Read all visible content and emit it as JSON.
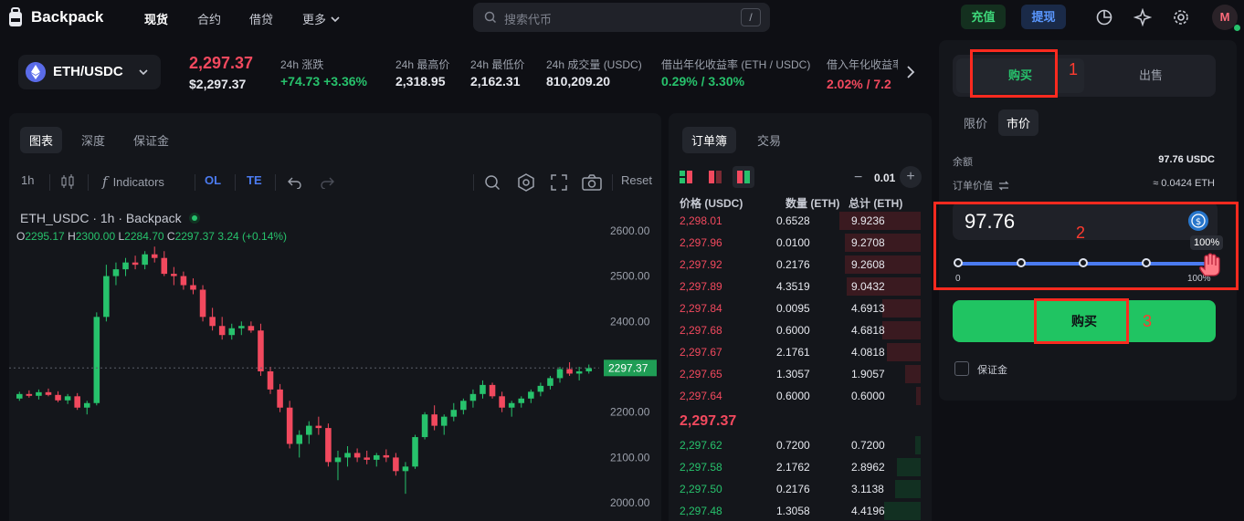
{
  "nav": {
    "brand": "Backpack",
    "items": [
      "现货",
      "合约",
      "借贷",
      "更多"
    ],
    "search_placeholder": "搜索代币",
    "search_shortcut": "/",
    "deposit": "充值",
    "withdraw": "提现",
    "avatar": "M"
  },
  "ticker": {
    "pair": "ETH/USDC",
    "last_price": "2,297.37",
    "last_usd": "$2,297.37",
    "stats": [
      {
        "label": "24h 涨跌",
        "value": "+74.73 +3.36%"
      },
      {
        "label": "24h 最高价",
        "value": "2,318.95"
      },
      {
        "label": "24h 最低价",
        "value": "2,162.31"
      },
      {
        "label": "24h 成交量 (USDC)",
        "value": "810,209.20"
      },
      {
        "label": "借出年化收益率 (ETH / USDC)",
        "value": "0.29% / 3.30%"
      },
      {
        "label": "借入年化收益率",
        "value": "2.02% / 7.2"
      }
    ]
  },
  "chart": {
    "tabs": [
      "图表",
      "深度",
      "保证金"
    ],
    "interval": "1h",
    "indicators": "Indicators",
    "ol": "OL",
    "te": "TE",
    "reset": "Reset",
    "title": "ETH_USDC · 1h · Backpack",
    "ohlc": {
      "o_label": "O",
      "o": "2295.17",
      "h_label": "H",
      "h": "2300.00",
      "l_label": "L",
      "l": "2284.70",
      "c_label": "C",
      "c": "2297.37",
      "change": "3.24 (+0.14%)"
    },
    "current_price_tag": "2297.37"
  },
  "chart_data": {
    "type": "candlestick",
    "title": "ETH_USDC · 1h · Backpack",
    "y_ticks": [
      "2600.00",
      "2500.00",
      "2400.00",
      "2300.00",
      "2200.00",
      "2100.00",
      "2000.00"
    ],
    "ylim": [
      1960,
      2640
    ],
    "last": 2297.37,
    "candles": [
      [
        2230,
        2245,
        2225,
        2240
      ],
      [
        2240,
        2248,
        2232,
        2236
      ],
      [
        2236,
        2250,
        2228,
        2244
      ],
      [
        2244,
        2252,
        2235,
        2238
      ],
      [
        2238,
        2246,
        2222,
        2226
      ],
      [
        2226,
        2240,
        2218,
        2235
      ],
      [
        2235,
        2242,
        2205,
        2210
      ],
      [
        2210,
        2225,
        2195,
        2220
      ],
      [
        2220,
        2420,
        2215,
        2410
      ],
      [
        2410,
        2525,
        2400,
        2500
      ],
      [
        2500,
        2530,
        2480,
        2515
      ],
      [
        2515,
        2540,
        2500,
        2530
      ],
      [
        2530,
        2545,
        2515,
        2525
      ],
      [
        2525,
        2555,
        2515,
        2548
      ],
      [
        2548,
        2565,
        2530,
        2540
      ],
      [
        2540,
        2555,
        2500,
        2505
      ],
      [
        2505,
        2520,
        2480,
        2500
      ],
      [
        2500,
        2510,
        2470,
        2480
      ],
      [
        2480,
        2495,
        2460,
        2470
      ],
      [
        2470,
        2480,
        2400,
        2410
      ],
      [
        2410,
        2430,
        2380,
        2390
      ],
      [
        2390,
        2410,
        2360,
        2370
      ],
      [
        2370,
        2395,
        2360,
        2385
      ],
      [
        2385,
        2400,
        2370,
        2390
      ],
      [
        2390,
        2400,
        2375,
        2380
      ],
      [
        2380,
        2395,
        2280,
        2290
      ],
      [
        2290,
        2300,
        2240,
        2250
      ],
      [
        2250,
        2262,
        2200,
        2210
      ],
      [
        2210,
        2225,
        2120,
        2130
      ],
      [
        2130,
        2160,
        2100,
        2150
      ],
      [
        2150,
        2180,
        2130,
        2170
      ],
      [
        2170,
        2190,
        2150,
        2165
      ],
      [
        2165,
        2175,
        2080,
        2090
      ],
      [
        2090,
        2115,
        2050,
        2100
      ],
      [
        2100,
        2125,
        2080,
        2110
      ],
      [
        2110,
        2120,
        2090,
        2100
      ],
      [
        2100,
        2115,
        2085,
        2095
      ],
      [
        2095,
        2110,
        2080,
        2105
      ],
      [
        2105,
        2118,
        2090,
        2100
      ],
      [
        2100,
        2110,
        2060,
        2070
      ],
      [
        2070,
        2090,
        2020,
        2080
      ],
      [
        2080,
        2150,
        2075,
        2145
      ],
      [
        2145,
        2200,
        2140,
        2195
      ],
      [
        2195,
        2215,
        2160,
        2170
      ],
      [
        2170,
        2195,
        2150,
        2190
      ],
      [
        2190,
        2220,
        2180,
        2205
      ],
      [
        2205,
        2230,
        2195,
        2225
      ],
      [
        2225,
        2250,
        2210,
        2240
      ],
      [
        2240,
        2270,
        2230,
        2260
      ],
      [
        2260,
        2265,
        2230,
        2235
      ],
      [
        2235,
        2245,
        2200,
        2210
      ],
      [
        2210,
        2225,
        2190,
        2220
      ],
      [
        2220,
        2235,
        2210,
        2230
      ],
      [
        2230,
        2250,
        2220,
        2245
      ],
      [
        2245,
        2265,
        2235,
        2258
      ],
      [
        2258,
        2280,
        2250,
        2275
      ],
      [
        2275,
        2300,
        2265,
        2295
      ],
      [
        2295,
        2310,
        2280,
        2285
      ],
      [
        2285,
        2300,
        2270,
        2290
      ],
      [
        2290,
        2305,
        2285,
        2297
      ]
    ]
  },
  "book": {
    "tabs": [
      "订单簿",
      "交易"
    ],
    "tick": "0.01",
    "headers": [
      "价格 (USDC)",
      "数量 (ETH)",
      "总计 (ETH)"
    ],
    "asks": [
      [
        "2,298.01",
        "0.6528",
        "9.9236"
      ],
      [
        "2,297.96",
        "0.0100",
        "9.2708"
      ],
      [
        "2,297.92",
        "0.2176",
        "9.2608"
      ],
      [
        "2,297.89",
        "4.3519",
        "9.0432"
      ],
      [
        "2,297.84",
        "0.0095",
        "4.6913"
      ],
      [
        "2,297.68",
        "0.6000",
        "4.6818"
      ],
      [
        "2,297.67",
        "2.1761",
        "4.0818"
      ],
      [
        "2,297.65",
        "1.3057",
        "1.9057"
      ],
      [
        "2,297.64",
        "0.6000",
        "0.6000"
      ]
    ],
    "mid": "2,297.37",
    "bids": [
      [
        "2,297.62",
        "0.7200",
        "0.7200"
      ],
      [
        "2,297.58",
        "2.1762",
        "2.8962"
      ],
      [
        "2,297.50",
        "0.2176",
        "3.1138"
      ],
      [
        "2,297.48",
        "1.3058",
        "4.4196"
      ]
    ]
  },
  "form": {
    "buy_tab": "购买",
    "sell_tab": "出售",
    "limit": "限价",
    "market": "市价",
    "balance_label": "余额",
    "balance_value": "97.76 USDC",
    "order_value_label": "订单价值",
    "order_value": "≈ 0.0424 ETH",
    "amount": "97.76",
    "pct_tag": "100%",
    "slider_min": "0",
    "slider_max": "100%",
    "slider_value": 100,
    "buy_button": "购买",
    "margin_label": "保证金"
  },
  "annotations": [
    "1",
    "2",
    "3"
  ],
  "colors": {
    "up": "#27c26c",
    "down": "#f2495e",
    "accent": "#4b7bf0",
    "annotation": "#ff2a1f"
  }
}
